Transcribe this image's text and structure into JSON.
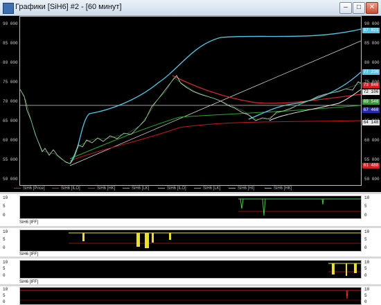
{
  "window": {
    "title": "Графики [SiH6] #2 - [60 минут]"
  },
  "main_chart": {
    "y_ticks": [
      "90 000",
      "85 000",
      "80 000",
      "75 000",
      "70 000",
      "65 000",
      "60 000",
      "55 000",
      "50 000"
    ],
    "right_labels": [
      {
        "text": "87 821",
        "color": "#55c8e8"
      },
      {
        "text": "77 236",
        "color": "#55c8e8"
      },
      {
        "text": "73 840",
        "color": "#d62020"
      },
      {
        "text": "72 106",
        "color": "#e8e8e8"
      },
      {
        "text": "69 548",
        "color": "#3a9a3a"
      },
      {
        "text": "67 460",
        "color": "#2a2ab0"
      },
      {
        "text": "64 148",
        "color": "#e8e8e8"
      },
      {
        "text": "61 488",
        "color": "#d62020"
      }
    ],
    "legend": [
      {
        "label": "SiH6 [Price]",
        "color": "#d62020"
      },
      {
        "label": "SiH6 [ILO]",
        "color": "#d62020"
      },
      {
        "label": "SiH6 [HK]",
        "color": "#d62020"
      },
      {
        "label": "SiH6 [LK]",
        "color": "#3ad03a"
      },
      {
        "label": "SiH6 [ILO]",
        "color": "#9a9a9a"
      },
      {
        "label": "SiH6 [LK]",
        "color": "#3ad03a"
      },
      {
        "label": "SiH6 [HI]",
        "color": "#55c8e8"
      },
      {
        "label": "SiH6 [HK]",
        "color": "#55c8e8"
      }
    ]
  },
  "sub_panels": [
    {
      "label": "SiH6 [IFF]",
      "ticks": [
        "10",
        "5",
        "0"
      ]
    },
    {
      "label": "SiH6 [IFF]",
      "ticks": [
        "10",
        "5",
        "0"
      ]
    },
    {
      "label": "SiH6 [IFF]",
      "ticks": [
        "10",
        "5",
        "0"
      ]
    },
    {
      "label": "",
      "ticks": [
        "10",
        "5",
        "0"
      ]
    }
  ]
}
